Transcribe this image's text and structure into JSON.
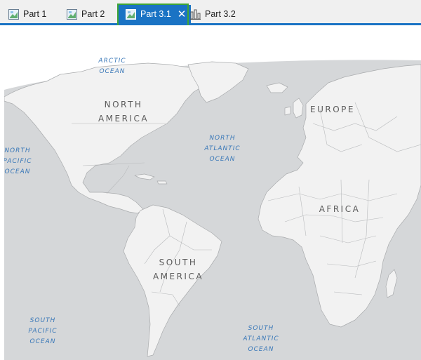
{
  "tabs": [
    {
      "label": "Part 1",
      "icon": "map-icon",
      "active": false
    },
    {
      "label": "Part 2",
      "icon": "map-icon",
      "active": false
    },
    {
      "label": "Part 3.1",
      "icon": "map-icon",
      "active": true
    },
    {
      "label": "Part 3.2",
      "icon": "layout-icon",
      "active": false
    }
  ],
  "active_tab_close": "✕",
  "map": {
    "ocean_color": "#d5d7d9",
    "land_color": "#f2f2f2",
    "border_color": "#a9abad",
    "labels": {
      "arctic": "ARCTIC\nOCEAN",
      "north_pacific": "NORTH\nPACIFIC\nOCEAN",
      "north_atlantic": "NORTH\nATLANTIC\nOCEAN",
      "south_pacific": "SOUTH\nPACIFIC\nOCEAN",
      "south_atlantic": "SOUTH\nATLANTIC\nOCEAN",
      "north_america": "NORTH\nAMERICA",
      "south_america": "SOUTH\nAMERICA",
      "europe": "EUROPE",
      "africa": "AFRICA"
    }
  }
}
